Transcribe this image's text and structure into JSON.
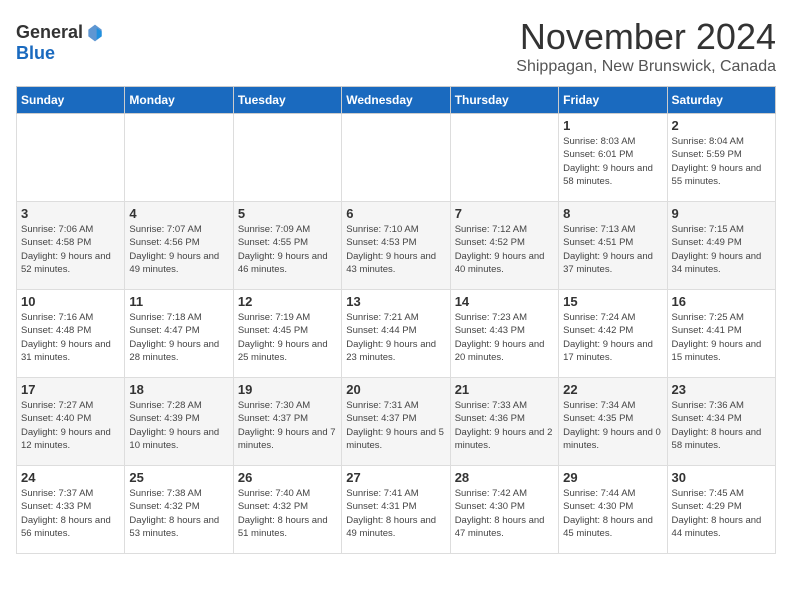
{
  "logo": {
    "general": "General",
    "blue": "Blue"
  },
  "title": {
    "month": "November 2024",
    "location": "Shippagan, New Brunswick, Canada"
  },
  "days_of_week": [
    "Sunday",
    "Monday",
    "Tuesday",
    "Wednesday",
    "Thursday",
    "Friday",
    "Saturday"
  ],
  "weeks": [
    [
      {
        "day": "",
        "info": ""
      },
      {
        "day": "",
        "info": ""
      },
      {
        "day": "",
        "info": ""
      },
      {
        "day": "",
        "info": ""
      },
      {
        "day": "",
        "info": ""
      },
      {
        "day": "1",
        "info": "Sunrise: 8:03 AM\nSunset: 6:01 PM\nDaylight: 9 hours and 58 minutes."
      },
      {
        "day": "2",
        "info": "Sunrise: 8:04 AM\nSunset: 5:59 PM\nDaylight: 9 hours and 55 minutes."
      }
    ],
    [
      {
        "day": "3",
        "info": "Sunrise: 7:06 AM\nSunset: 4:58 PM\nDaylight: 9 hours and 52 minutes."
      },
      {
        "day": "4",
        "info": "Sunrise: 7:07 AM\nSunset: 4:56 PM\nDaylight: 9 hours and 49 minutes."
      },
      {
        "day": "5",
        "info": "Sunrise: 7:09 AM\nSunset: 4:55 PM\nDaylight: 9 hours and 46 minutes."
      },
      {
        "day": "6",
        "info": "Sunrise: 7:10 AM\nSunset: 4:53 PM\nDaylight: 9 hours and 43 minutes."
      },
      {
        "day": "7",
        "info": "Sunrise: 7:12 AM\nSunset: 4:52 PM\nDaylight: 9 hours and 40 minutes."
      },
      {
        "day": "8",
        "info": "Sunrise: 7:13 AM\nSunset: 4:51 PM\nDaylight: 9 hours and 37 minutes."
      },
      {
        "day": "9",
        "info": "Sunrise: 7:15 AM\nSunset: 4:49 PM\nDaylight: 9 hours and 34 minutes."
      }
    ],
    [
      {
        "day": "10",
        "info": "Sunrise: 7:16 AM\nSunset: 4:48 PM\nDaylight: 9 hours and 31 minutes."
      },
      {
        "day": "11",
        "info": "Sunrise: 7:18 AM\nSunset: 4:47 PM\nDaylight: 9 hours and 28 minutes."
      },
      {
        "day": "12",
        "info": "Sunrise: 7:19 AM\nSunset: 4:45 PM\nDaylight: 9 hours and 25 minutes."
      },
      {
        "day": "13",
        "info": "Sunrise: 7:21 AM\nSunset: 4:44 PM\nDaylight: 9 hours and 23 minutes."
      },
      {
        "day": "14",
        "info": "Sunrise: 7:23 AM\nSunset: 4:43 PM\nDaylight: 9 hours and 20 minutes."
      },
      {
        "day": "15",
        "info": "Sunrise: 7:24 AM\nSunset: 4:42 PM\nDaylight: 9 hours and 17 minutes."
      },
      {
        "day": "16",
        "info": "Sunrise: 7:25 AM\nSunset: 4:41 PM\nDaylight: 9 hours and 15 minutes."
      }
    ],
    [
      {
        "day": "17",
        "info": "Sunrise: 7:27 AM\nSunset: 4:40 PM\nDaylight: 9 hours and 12 minutes."
      },
      {
        "day": "18",
        "info": "Sunrise: 7:28 AM\nSunset: 4:39 PM\nDaylight: 9 hours and 10 minutes."
      },
      {
        "day": "19",
        "info": "Sunrise: 7:30 AM\nSunset: 4:37 PM\nDaylight: 9 hours and 7 minutes."
      },
      {
        "day": "20",
        "info": "Sunrise: 7:31 AM\nSunset: 4:37 PM\nDaylight: 9 hours and 5 minutes."
      },
      {
        "day": "21",
        "info": "Sunrise: 7:33 AM\nSunset: 4:36 PM\nDaylight: 9 hours and 2 minutes."
      },
      {
        "day": "22",
        "info": "Sunrise: 7:34 AM\nSunset: 4:35 PM\nDaylight: 9 hours and 0 minutes."
      },
      {
        "day": "23",
        "info": "Sunrise: 7:36 AM\nSunset: 4:34 PM\nDaylight: 8 hours and 58 minutes."
      }
    ],
    [
      {
        "day": "24",
        "info": "Sunrise: 7:37 AM\nSunset: 4:33 PM\nDaylight: 8 hours and 56 minutes."
      },
      {
        "day": "25",
        "info": "Sunrise: 7:38 AM\nSunset: 4:32 PM\nDaylight: 8 hours and 53 minutes."
      },
      {
        "day": "26",
        "info": "Sunrise: 7:40 AM\nSunset: 4:32 PM\nDaylight: 8 hours and 51 minutes."
      },
      {
        "day": "27",
        "info": "Sunrise: 7:41 AM\nSunset: 4:31 PM\nDaylight: 8 hours and 49 minutes."
      },
      {
        "day": "28",
        "info": "Sunrise: 7:42 AM\nSunset: 4:30 PM\nDaylight: 8 hours and 47 minutes."
      },
      {
        "day": "29",
        "info": "Sunrise: 7:44 AM\nSunset: 4:30 PM\nDaylight: 8 hours and 45 minutes."
      },
      {
        "day": "30",
        "info": "Sunrise: 7:45 AM\nSunset: 4:29 PM\nDaylight: 8 hours and 44 minutes."
      }
    ]
  ]
}
